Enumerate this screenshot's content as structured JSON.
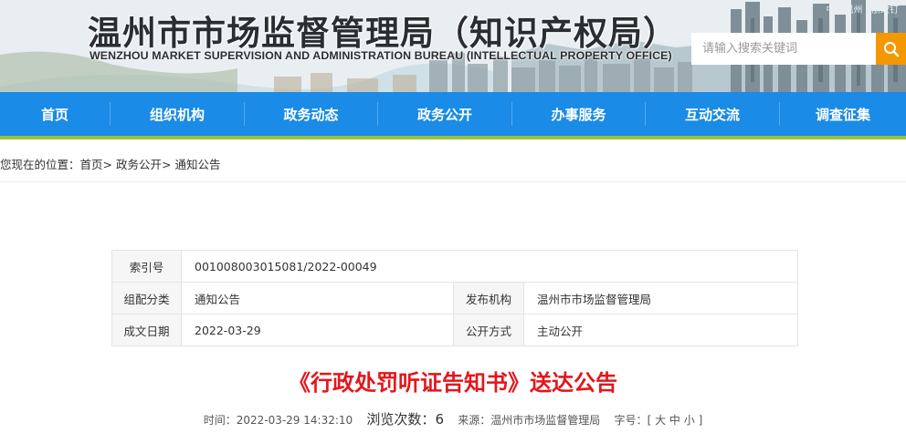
{
  "header": {
    "title": "温州市市场监督管理局（知识产权局）",
    "subtitle": "WENZHOU MARKET SUPERVISION AND ADMINISTRATION BUREAU (INTELLECTUAL PROPERTY OFFICE)",
    "top_links": "中国温州  ·  浙政钉",
    "search": {
      "placeholder": "请输入搜索关键词",
      "icon": "search-icon"
    },
    "colors": {
      "search_button": "#f39800"
    }
  },
  "nav": {
    "items": [
      {
        "label": "首页"
      },
      {
        "label": "组织机构"
      },
      {
        "label": "政务动态"
      },
      {
        "label": "政务公开"
      },
      {
        "label": "办事服务"
      },
      {
        "label": "互动交流"
      },
      {
        "label": "调查征集"
      }
    ],
    "colors": {
      "background": "#1a8be6",
      "underline": "#9cc03d"
    }
  },
  "breadcrumb": {
    "prefix": "您现在的位置：",
    "items": [
      {
        "label": "首页",
        "sep": ">"
      },
      {
        "label": "政务公开",
        "sep": ">"
      },
      {
        "label": "通知公告",
        "sep": ""
      }
    ]
  },
  "info": {
    "index_label": "索引号",
    "index_value": "001008003015081/2022-00049",
    "category_label": "组配分类",
    "category_value": "通知公告",
    "publisher_label": "发布机构",
    "publisher_value": "温州市市场监督管理局",
    "date_label": "成文日期",
    "date_value": "2022-03-29",
    "disclosure_label": "公开方式",
    "disclosure_value": "主动公开"
  },
  "article": {
    "title": "《行政处罚听证告知书》送达公告",
    "title_color": "#e4161b",
    "time_label": "时间：",
    "time_value": "2022-03-29 14:32:10",
    "views_label": "浏览次数：",
    "views_value": "6",
    "source_label": "来源：",
    "source_value": "温州市市场监督管理局",
    "font_label": "字号：",
    "font_open": "[",
    "font_large": "大",
    "font_medium": "中",
    "font_small": "小",
    "font_close": "]"
  }
}
